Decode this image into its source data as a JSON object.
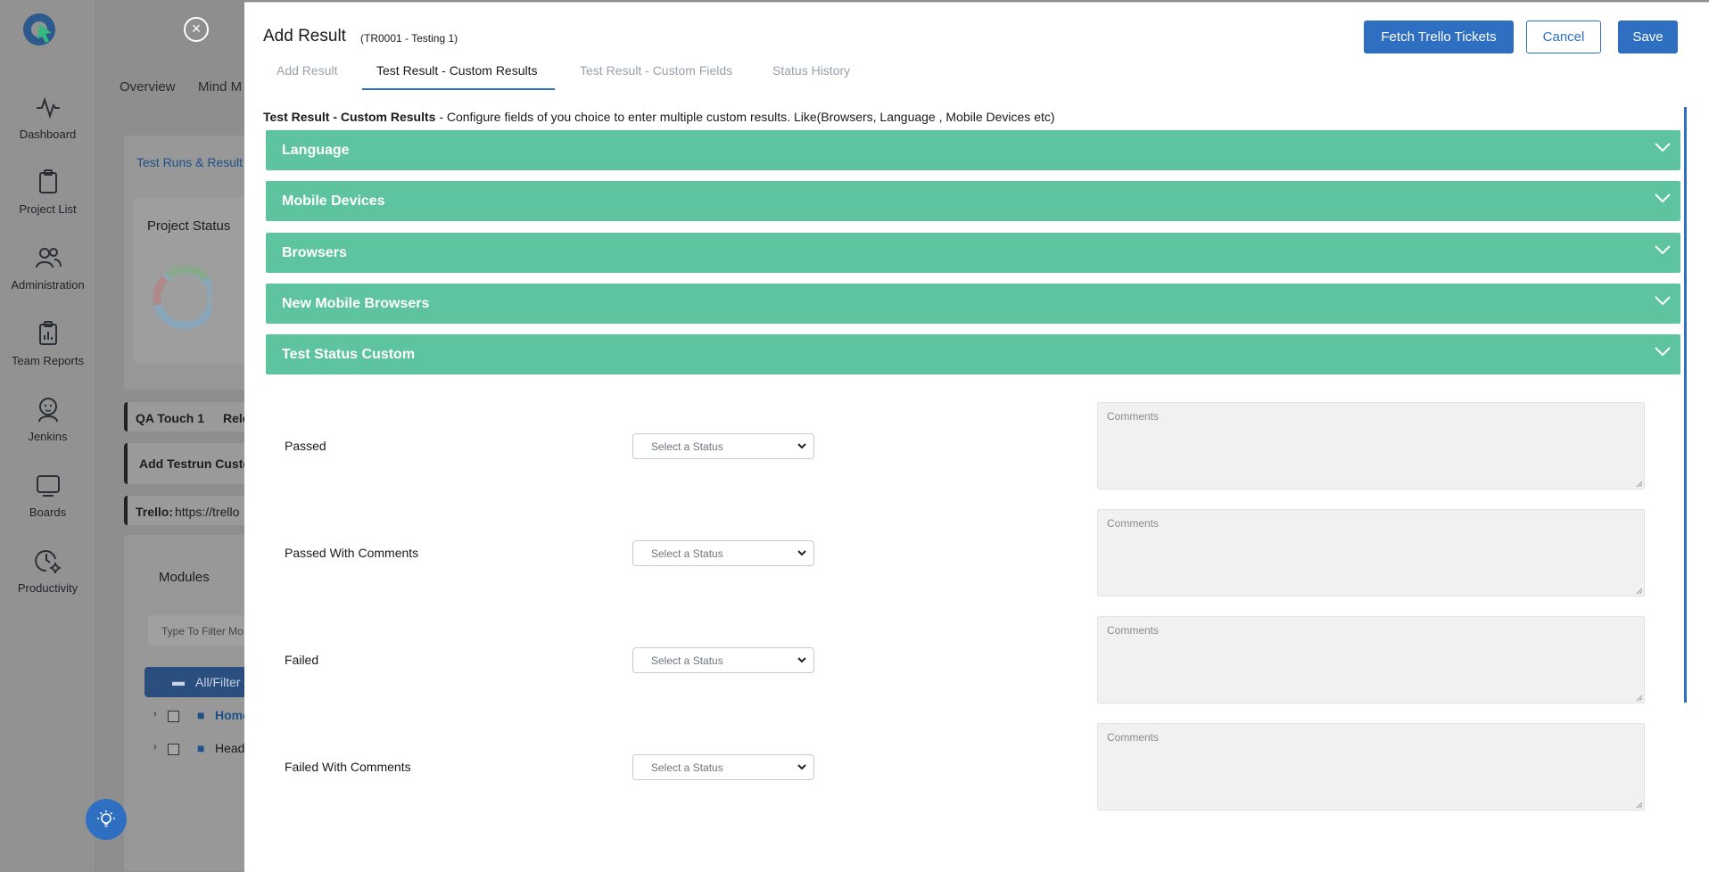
{
  "sidebar": {
    "items": [
      {
        "label": "Dashboard",
        "icon": "activity-icon"
      },
      {
        "label": "Project List",
        "icon": "clipboard-icon"
      },
      {
        "label": "Administration",
        "icon": "users-icon"
      },
      {
        "label": "Team Reports",
        "icon": "report-icon"
      },
      {
        "label": "Jenkins",
        "icon": "jenkins-icon"
      },
      {
        "label": "Boards",
        "icon": "board-icon"
      },
      {
        "label": "Productivity",
        "icon": "clock-gear-icon"
      }
    ]
  },
  "background": {
    "tabs": [
      "Overview",
      "Mind M"
    ],
    "breadcrumb": "Test Runs & Result",
    "project_status": "Project Status",
    "run_title": "QA Touch 1",
    "run_extra": "Rele",
    "add_testrun": "Add Testrun Custo",
    "trello_label": "Trello:",
    "trello_value": "https://trello",
    "modules_title": "Modules",
    "filter_placeholder": "Type To Filter Mo",
    "all_filter": "All/Filter",
    "tree": [
      "Home",
      "Head"
    ]
  },
  "modal": {
    "title": "Add Result",
    "subtitle": "(TR0001 - Testing 1)",
    "buttons": {
      "fetch": "Fetch Trello Tickets",
      "cancel": "Cancel",
      "save": "Save"
    },
    "tabs": [
      "Add Result",
      "Test Result - Custom Results",
      "Test Result - Custom Fields",
      "Status History"
    ],
    "active_tab": "Test Result - Custom Results",
    "description": {
      "bold": "Test Result - Custom Results",
      "text": " - Configure fields of you choice to enter multiple custom results. Like(Browsers, Language , Mobile Devices etc)"
    },
    "sections": [
      "Language",
      "Mobile Devices",
      "Browsers",
      "New Mobile Browsers",
      "Test Status Custom"
    ],
    "rows": [
      {
        "label": "Passed",
        "select_placeholder": "Select a Status",
        "comments_placeholder": "Comments"
      },
      {
        "label": "Passed With Comments",
        "select_placeholder": "Select a Status",
        "comments_placeholder": "Comments"
      },
      {
        "label": "Failed",
        "select_placeholder": "Select a Status",
        "comments_placeholder": "Comments"
      },
      {
        "label": "Failed With Comments",
        "select_placeholder": "Select a Status",
        "comments_placeholder": "Comments"
      }
    ]
  },
  "colors": {
    "accent": "#2f6fc1",
    "section": "#5ec4a0",
    "overlay": "#8e8e8e"
  }
}
